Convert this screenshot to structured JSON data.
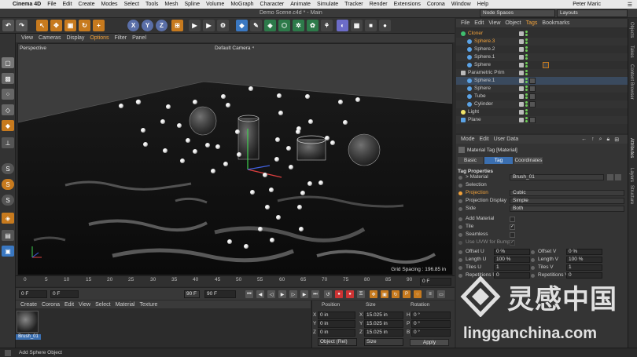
{
  "menubar": {
    "app": "Cinema 4D",
    "items": [
      "File",
      "Edit",
      "Create",
      "Modes",
      "Select",
      "Tools",
      "Mesh",
      "Spline",
      "Volume",
      "MoGraph",
      "Character",
      "Animate",
      "Simulate",
      "Tracker",
      "Render",
      "Extensions",
      "Corona",
      "Window",
      "Help"
    ],
    "user": "Peter Maric"
  },
  "window": {
    "title": "Demo Scene.c4d * - Main",
    "node_spaces": "Node Spaces",
    "layouts": "Layouts"
  },
  "toolbar": {
    "axis_x": "X",
    "axis_y": "Y",
    "axis_z": "Z"
  },
  "viewport": {
    "menu": [
      "View",
      "Cameras",
      "Display",
      "Options",
      "Filter",
      "Panel"
    ],
    "active_menu": "Options",
    "perspective": "Perspective",
    "camera": "Default Camera ⁴",
    "grid_spacing": "Grid Spacing : 196.85 in"
  },
  "timeline": {
    "ticks": [
      "0",
      "5",
      "10",
      "15",
      "20",
      "25",
      "30",
      "35",
      "40",
      "45",
      "50",
      "55",
      "60",
      "65",
      "70",
      "75",
      "80",
      "85",
      "90"
    ],
    "frame_end_field": "0 F",
    "current_frame": "0 F",
    "start_frame": "0 F",
    "end_frame": "90 F",
    "end_frame_2": "90 F"
  },
  "material_manager": {
    "menu": [
      "Create",
      "Corona",
      "Edit",
      "View",
      "Select",
      "Material",
      "Texture"
    ],
    "material_name": "Brush_01"
  },
  "coordinates": {
    "headers": [
      "Position",
      "Size",
      "Rotation"
    ],
    "rows": [
      {
        "axis": "X",
        "pos": "0 in",
        "size_axis": "X",
        "size": "15.025 in",
        "rot_axis": "H",
        "rot": "0 °"
      },
      {
        "axis": "Y",
        "pos": "0 in",
        "size_axis": "Y",
        "size": "15.025 in",
        "rot_axis": "P",
        "rot": "0 °"
      },
      {
        "axis": "Z",
        "pos": "0 in",
        "size_axis": "Z",
        "size": "15.025 in",
        "rot_axis": "B",
        "rot": "0 °"
      }
    ],
    "mode": "Object (Rel)",
    "size_mode": "Size",
    "apply": "Apply"
  },
  "status": "Add Sphere Object",
  "object_manager": {
    "menu": [
      "File",
      "Edit",
      "View",
      "Object",
      "Tags",
      "Bookmarks"
    ],
    "active_menu": "Tags",
    "objects": [
      {
        "name": "Cloner",
        "indent": 0,
        "color": "#f2a23a"
      },
      {
        "name": "Sphere.3",
        "indent": 1,
        "color": "#f2a23a"
      },
      {
        "name": "Sphere.2",
        "indent": 1,
        "color": "#c8c8c8"
      },
      {
        "name": "Sphere.1",
        "indent": 1,
        "color": "#c8c8c8"
      },
      {
        "name": "Sphere",
        "indent": 1,
        "color": "#c8c8c8"
      },
      {
        "name": "Parametric Prim",
        "indent": 0,
        "color": "#c8c8c8"
      },
      {
        "name": "Sphere.1",
        "indent": 1,
        "color": "#c8c8c8"
      },
      {
        "name": "Sphere",
        "indent": 1,
        "color": "#c8c8c8"
      },
      {
        "name": "Tube",
        "indent": 1,
        "color": "#c8c8c8"
      },
      {
        "name": "Cylinder",
        "indent": 1,
        "color": "#c8c8c8"
      },
      {
        "name": "Light",
        "indent": 0,
        "color": "#c8c8c8"
      },
      {
        "name": "Plane",
        "indent": 0,
        "color": "#c8c8c8"
      }
    ]
  },
  "attributes": {
    "menu": [
      "Mode",
      "Edit",
      "User Data"
    ],
    "header": "Material Tag [Material]",
    "tabs": [
      "Basic",
      "Tag",
      "Coordinates"
    ],
    "active_tab": "Tag",
    "section": "Tag Properties",
    "material_label": "> Material",
    "material_value": "Brush_01",
    "selection_label": "Selection",
    "projection_label": "Projection",
    "projection_value": "Cubic",
    "projection_display_label": "Projection Display",
    "projection_display_value": "Simple",
    "side_label": "Side",
    "side_value": "Both",
    "add_material_label": "Add Material",
    "tile_label": "Tile",
    "tile_checked": "✓",
    "seamless_label": "Seamless",
    "uvw_label": "Use UVW for Bump",
    "uvw_checked": "✓",
    "offset_u_label": "Offset U",
    "offset_u": "0 %",
    "offset_v_label": "Offset V",
    "offset_v": "0 %",
    "length_u_label": "Length U",
    "length_u": "100 %",
    "length_v_label": "Length V",
    "length_v": "100 %",
    "tiles_u_label": "Tiles U",
    "tiles_u": "1",
    "tiles_v_label": "Tiles V",
    "tiles_v": "1",
    "rep_u_label": "Repetitions U",
    "rep_u": "0",
    "rep_v_label": "Repetitions V",
    "rep_v": "0"
  },
  "right_tabs": [
    "Objects",
    "Takes",
    "Content Browser",
    "Attributes",
    "Layers",
    "Structure"
  ],
  "watermark": {
    "chinese": "灵感中国",
    "url": "lingganchina.com"
  }
}
